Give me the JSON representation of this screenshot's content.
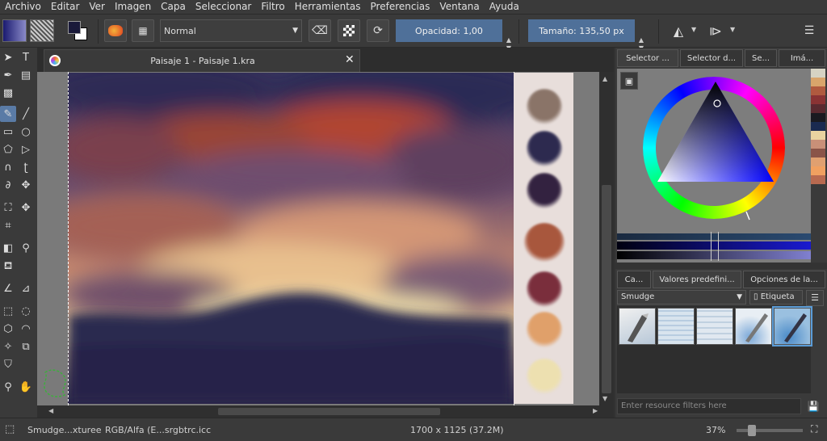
{
  "menu": [
    "Archivo",
    "Editar",
    "Ver",
    "Imagen",
    "Capa",
    "Seleccionar",
    "Filtro",
    "Herramientas",
    "Preferencias",
    "Ventana",
    "Ayuda"
  ],
  "toolbar": {
    "blend_mode": "Normal",
    "opacity_label": "Opacidad:  1,00",
    "size_label": "Tamaño:  135,50 px"
  },
  "document": {
    "tab_title": "Paisaje 1 - Paisaje 1.kra",
    "close_glyph": "✕"
  },
  "dock": {
    "tabs_top": [
      "Selector ...",
      "Selector d...",
      "Se...",
      "Imá..."
    ],
    "tabs_bottom": [
      "Ca...",
      "Valores predefini...",
      "Opciones de la..."
    ],
    "preset_group": "Smudge",
    "tag_label": "Etiqueta",
    "filter_placeholder": "Enter resource filters here"
  },
  "status": {
    "preset": "Smudge...xturee",
    "color_profile": "RGB/Alfa (E...srgbtrc.icc",
    "dimensions": "1700 x 1125 (37.2M)",
    "zoom": "37%"
  },
  "colors": {
    "accent": "#4f7099",
    "palette_swatches": [
      "#d6d3c3",
      "#d9a56b",
      "#b05a3f",
      "#8a3334",
      "#5a2a30",
      "#1a1a20",
      "#1a2a50",
      "#e9d3a0",
      "#c99078",
      "#8a5448",
      "#e0a070",
      "#f0a060",
      "#b86a50"
    ],
    "painted_blobs": [
      "#8a7468",
      "#2d2a4f",
      "#332240",
      "#a8573d",
      "#7a2e3c",
      "#e0a06a",
      "#ede0b0"
    ]
  }
}
